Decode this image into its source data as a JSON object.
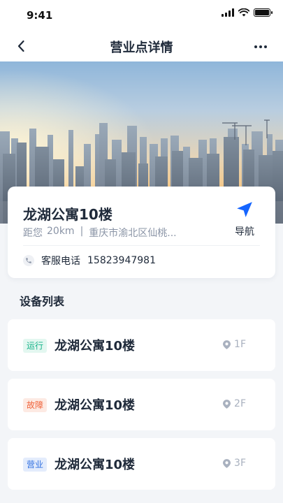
{
  "status_bar": {
    "time": "9:41"
  },
  "nav": {
    "title": "营业点详情"
  },
  "site": {
    "name": "龙湖公寓10楼",
    "distance_prefix": "距您",
    "distance": "20km",
    "separator": "|",
    "address": "重庆市渝北区仙桃...",
    "phone_label": "客服电话",
    "phone": "15823947981",
    "navigate_label": "导航"
  },
  "devices_section": {
    "title": "设备列表"
  },
  "devices": [
    {
      "tag": "运行",
      "name": "龙湖公寓10楼",
      "floor": "1F",
      "tag_color": "#17b38a",
      "tag_bg": "#e3f7f0"
    },
    {
      "tag": "故障",
      "name": "龙湖公寓10楼",
      "floor": "2F",
      "tag_color": "#f0643c",
      "tag_bg": "#fdeae3"
    },
    {
      "tag": "营业",
      "name": "龙湖公寓10楼",
      "floor": "3F",
      "tag_color": "#2f6fe0",
      "tag_bg": "#e3ecfc"
    }
  ],
  "icons": {
    "back": "chevron-left-icon",
    "more": "more-icon",
    "navigate": "navigation-arrow-icon",
    "phone": "phone-icon",
    "location": "location-pin-icon"
  },
  "colors": {
    "accent": "#1565ff",
    "text": "#1f2a3a",
    "muted": "#8a94a6"
  }
}
